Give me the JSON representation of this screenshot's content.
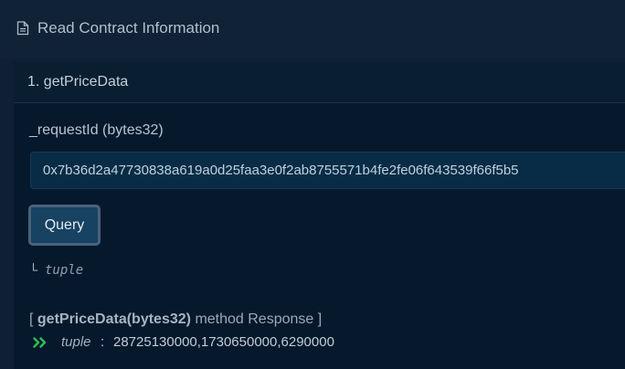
{
  "section": {
    "icon": "document-icon",
    "title": "Read Contract Information"
  },
  "method": {
    "title": "1. getPriceData",
    "param_label": "_requestId (bytes32)",
    "param_value": "0x7b36d2a47730838a619a0d25faa3e0f2ab8755571b4fe2fe06f643539f66f5b5",
    "query_label": "Query",
    "return_arrow": "└",
    "return_type": "tuple"
  },
  "response": {
    "open_bracket": "[",
    "method_signature": "getPriceData(bytes32)",
    "suffix": "method Response ]",
    "result_icon": "double-chevron-right-icon",
    "result_type": "tuple",
    "separator": ":",
    "result_value": "28725130000,1730650000,6290000"
  },
  "colors": {
    "background": "#0f2034",
    "card": "#06192c",
    "input": "#092c46",
    "button": "#174262",
    "success": "#2fbf55"
  }
}
